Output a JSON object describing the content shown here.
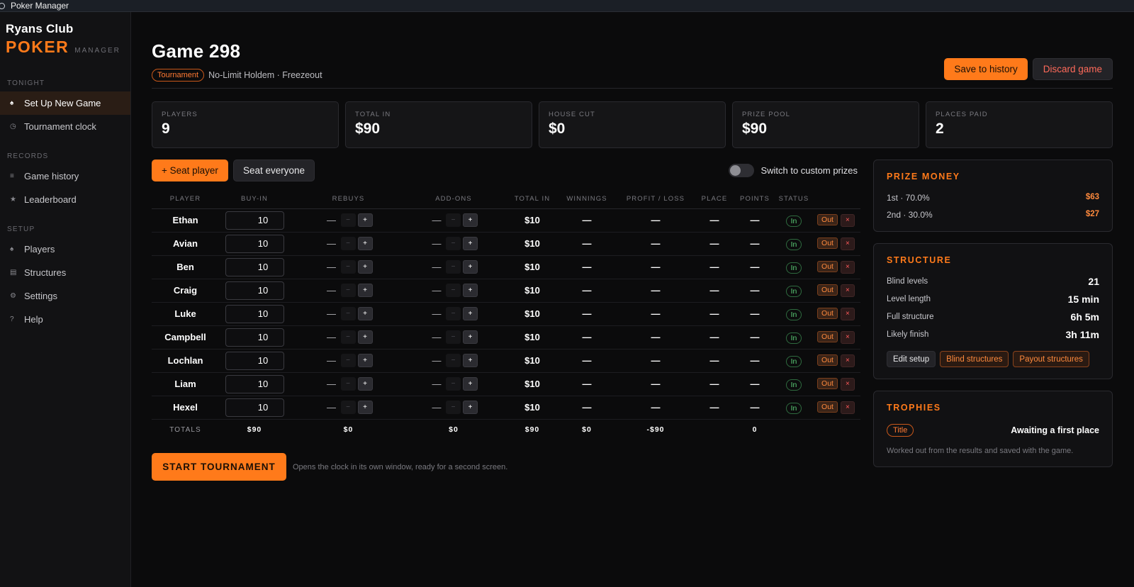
{
  "window": {
    "title": "Poker Manager"
  },
  "sidebar": {
    "club": "Ryans Club",
    "logo": "POKER",
    "logo_sub": "MANAGER",
    "sections": [
      {
        "label": "TONIGHT",
        "items": [
          {
            "label": "Set Up New Game",
            "icon": "spade-icon",
            "glyph": "♠",
            "active": true
          },
          {
            "label": "Tournament clock",
            "icon": "clock-icon",
            "glyph": "◷",
            "active": false
          }
        ]
      },
      {
        "label": "RECORDS",
        "items": [
          {
            "label": "Game history",
            "icon": "list-icon",
            "glyph": "≡",
            "active": false
          },
          {
            "label": "Leaderboard",
            "icon": "star-icon",
            "glyph": "★",
            "active": false
          }
        ]
      },
      {
        "label": "SETUP",
        "items": [
          {
            "label": "Players",
            "icon": "spade-icon",
            "glyph": "♠",
            "active": false
          },
          {
            "label": "Structures",
            "icon": "table-icon",
            "glyph": "▤",
            "active": false
          },
          {
            "label": "Settings",
            "icon": "gear-icon",
            "glyph": "⚙",
            "active": false
          },
          {
            "label": "Help",
            "icon": "help-icon",
            "glyph": "?",
            "active": false
          }
        ]
      }
    ]
  },
  "header": {
    "title": "Game 298",
    "badge": "Tournament",
    "subtitle": "No-Limit Holdem · Freezeout",
    "save_label": "Save to history",
    "discard_label": "Discard game"
  },
  "stats": [
    {
      "label": "PLAYERS",
      "value": "9"
    },
    {
      "label": "TOTAL IN",
      "value": "$90"
    },
    {
      "label": "HOUSE CUT",
      "value": "$0"
    },
    {
      "label": "PRIZE POOL",
      "value": "$90"
    },
    {
      "label": "PLACES PAID",
      "value": "2"
    }
  ],
  "actions": {
    "seat_player": "+ Seat player",
    "seat_everyone": "Seat everyone",
    "custom_prizes": "Switch to custom prizes"
  },
  "table": {
    "columns": [
      "PLAYER",
      "BUY-IN",
      "REBUYS",
      "ADD-ONS",
      "TOTAL IN",
      "WINNINGS",
      "PROFIT / LOSS",
      "PLACE",
      "POINTS",
      "STATUS"
    ],
    "rows": [
      {
        "name": "Ethan",
        "buyin": "10",
        "rebuys": "—",
        "addons": "—",
        "total": "$10",
        "winnings": "—",
        "profit": "—",
        "place": "—",
        "points": "—",
        "status": "In"
      },
      {
        "name": "Avian",
        "buyin": "10",
        "rebuys": "—",
        "addons": "—",
        "total": "$10",
        "winnings": "—",
        "profit": "—",
        "place": "—",
        "points": "—",
        "status": "In"
      },
      {
        "name": "Ben",
        "buyin": "10",
        "rebuys": "—",
        "addons": "—",
        "total": "$10",
        "winnings": "—",
        "profit": "—",
        "place": "—",
        "points": "—",
        "status": "In"
      },
      {
        "name": "Craig",
        "buyin": "10",
        "rebuys": "—",
        "addons": "—",
        "total": "$10",
        "winnings": "—",
        "profit": "—",
        "place": "—",
        "points": "—",
        "status": "In"
      },
      {
        "name": "Luke",
        "buyin": "10",
        "rebuys": "—",
        "addons": "—",
        "total": "$10",
        "winnings": "—",
        "profit": "—",
        "place": "—",
        "points": "—",
        "status": "In"
      },
      {
        "name": "Campbell",
        "buyin": "10",
        "rebuys": "—",
        "addons": "—",
        "total": "$10",
        "winnings": "—",
        "profit": "—",
        "place": "—",
        "points": "—",
        "status": "In"
      },
      {
        "name": "Lochlan",
        "buyin": "10",
        "rebuys": "—",
        "addons": "—",
        "total": "$10",
        "winnings": "—",
        "profit": "—",
        "place": "—",
        "points": "—",
        "status": "In"
      },
      {
        "name": "Liam",
        "buyin": "10",
        "rebuys": "—",
        "addons": "—",
        "total": "$10",
        "winnings": "—",
        "profit": "—",
        "place": "—",
        "points": "—",
        "status": "In"
      },
      {
        "name": "Hexel",
        "buyin": "10",
        "rebuys": "—",
        "addons": "—",
        "total": "$10",
        "winnings": "—",
        "profit": "—",
        "place": "—",
        "points": "—",
        "status": "In"
      }
    ],
    "out_label": "Out",
    "remove_label": "×",
    "minus_label": "−",
    "plus_label": "+",
    "totals": {
      "label": "TOTALS",
      "buyin": "$90",
      "rebuys": "$0",
      "addons": "$0",
      "total": "$90",
      "winnings": "$0",
      "profit": "-$90",
      "points": "0"
    }
  },
  "start": {
    "label": "START TOURNAMENT",
    "hint": "Opens the clock in its own window, ready for a second screen."
  },
  "prize_money": {
    "title": "PRIZE MONEY",
    "rows": [
      {
        "label": "1st · 70.0%",
        "amount": "$63"
      },
      {
        "label": "2nd · 30.0%",
        "amount": "$27"
      }
    ]
  },
  "structure": {
    "title": "STRUCTURE",
    "rows": [
      {
        "label": "Blind levels",
        "value": "21"
      },
      {
        "label": "Level length",
        "value": "15 min"
      },
      {
        "label": "Full structure",
        "value": "6h 5m"
      },
      {
        "label": "Likely finish",
        "value": "3h 11m"
      }
    ],
    "edit_label": "Edit setup",
    "blind_label": "Blind structures",
    "payout_label": "Payout structures"
  },
  "trophies": {
    "title": "TROPHIES",
    "badge": "Title",
    "status": "Awaiting a first place",
    "note": "Worked out from the results and saved with the game."
  },
  "colors": {
    "accent": "#ff7a1a",
    "in_green": "#5ccf78",
    "danger": "#ff5a5a"
  }
}
